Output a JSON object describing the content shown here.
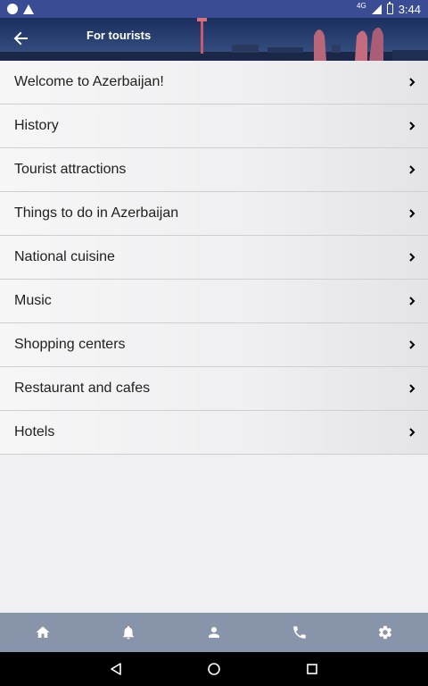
{
  "status_bar": {
    "network": "4G",
    "time": "3:44",
    "icons": [
      "circle-icon",
      "warning-icon",
      "signal-icon",
      "battery-icon"
    ]
  },
  "header": {
    "title": "For tourists",
    "back_icon": "arrow-left-icon"
  },
  "menu": {
    "items": [
      {
        "label": "Welcome to Azerbaijan!"
      },
      {
        "label": "History"
      },
      {
        "label": "Tourist attractions"
      },
      {
        "label": "Things to do in Azerbaijan"
      },
      {
        "label": "National cuisine"
      },
      {
        "label": "Music"
      },
      {
        "label": "Shopping centers"
      },
      {
        "label": "Restaurant and cafes"
      },
      {
        "label": "Hotels"
      }
    ],
    "chevron_icon": "chevron-right-icon"
  },
  "bottom_nav": {
    "items": [
      "home-icon",
      "bell-icon",
      "person-icon",
      "phone-icon",
      "gear-icon"
    ]
  },
  "system_nav": {
    "items": [
      "back-triangle-icon",
      "home-circle-icon",
      "recents-square-icon"
    ]
  },
  "colors": {
    "status_bar": "#3a4c93",
    "bottom_nav": "#8894a9",
    "background": "#f0f0f2"
  }
}
